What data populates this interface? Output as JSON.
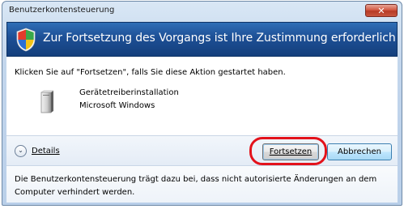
{
  "window": {
    "title": "Benutzerkontensteuerung",
    "close_glyph": "✕"
  },
  "banner": {
    "heading": "Zur Fortsetzung des Vorgangs ist Ihre Zustimmung erforderlich",
    "icon": "uac-shield-icon"
  },
  "content": {
    "prompt": "Klicken Sie auf \"Fortsetzen\", falls Sie diese Aktion gestartet haben.",
    "item": {
      "icon": "device-driver-icon",
      "name": "Gerätetreiberinstallation",
      "publisher": "Microsoft Windows"
    }
  },
  "actions": {
    "details_label": "Details",
    "continue_label": "Fortsetzen",
    "cancel_label": "Abbrechen"
  },
  "footer": {
    "text": "Die Benutzerkontensteuerung trägt dazu bei, dass nicht autorisierte Änderungen an dem Computer verhindert werden."
  },
  "colors": {
    "banner": "#1d4f95",
    "highlight": "#e3121b",
    "close": "#c8553e"
  }
}
